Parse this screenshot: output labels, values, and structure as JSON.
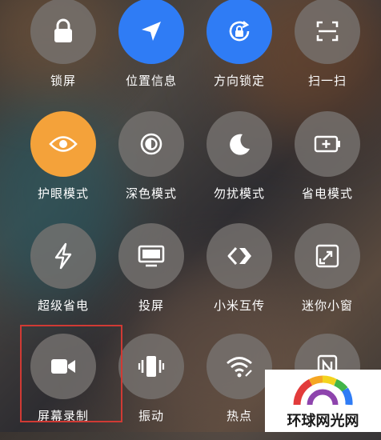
{
  "tiles": [
    {
      "label": "锁屏",
      "icon": "lock-icon"
    },
    {
      "label": "位置信息",
      "icon": "location-arrow-icon"
    },
    {
      "label": "方向锁定",
      "icon": "rotation-lock-icon"
    },
    {
      "label": "扫一扫",
      "icon": "scan-icon"
    },
    {
      "label": "护眼模式",
      "icon": "eye-icon"
    },
    {
      "label": "深色模式",
      "icon": "dark-mode-icon"
    },
    {
      "label": "勿扰模式",
      "icon": "moon-icon"
    },
    {
      "label": "省电模式",
      "icon": "battery-saver-icon"
    },
    {
      "label": "超级省电",
      "icon": "lightning-icon"
    },
    {
      "label": "投屏",
      "icon": "cast-screen-icon"
    },
    {
      "label": "小米互传",
      "icon": "mi-share-icon"
    },
    {
      "label": "迷你小窗",
      "icon": "mini-window-icon"
    },
    {
      "label": "屏幕录制",
      "icon": "video-camera-icon"
    },
    {
      "label": "振动",
      "icon": "vibrate-icon"
    },
    {
      "label": "热点",
      "icon": "hotspot-icon"
    },
    {
      "label": "",
      "icon": "nfc-icon"
    }
  ],
  "colors": {
    "active_blue": "#2f7cf5",
    "active_orange": "#f4a23a",
    "highlight_red": "#d03a34"
  },
  "watermark": {
    "text": "环球网光网",
    "logo": "colorful-arc-logo"
  }
}
